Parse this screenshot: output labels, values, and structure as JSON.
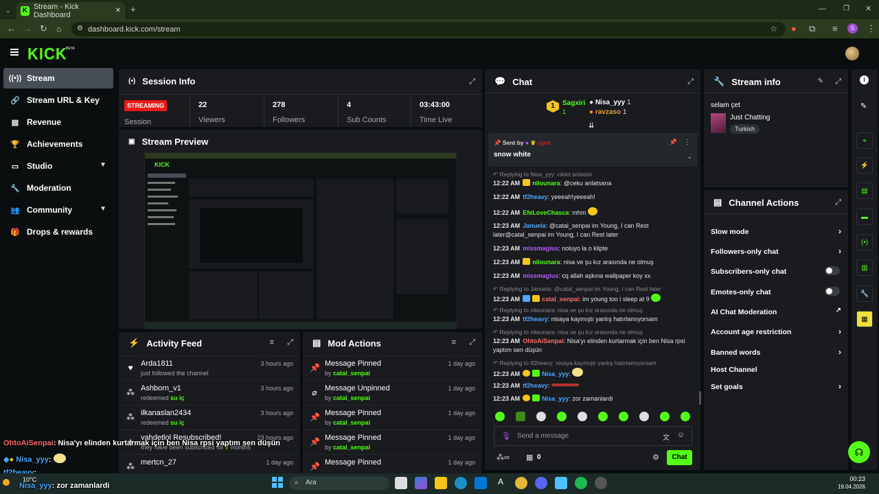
{
  "browser": {
    "tab_title": "Stream - Kick Dashboard",
    "url": "dashboard.kick.com/stream",
    "profile_initial": "S"
  },
  "header": {
    "logo": "KICK",
    "beta": "BETA"
  },
  "sidebar": {
    "items": [
      {
        "label": "Stream",
        "icon": "broadcast-icon",
        "active": true
      },
      {
        "label": "Stream URL & Key",
        "icon": "link-icon"
      },
      {
        "label": "Revenue",
        "icon": "chart-icon"
      },
      {
        "label": "Achievements",
        "icon": "trophy-icon"
      },
      {
        "label": "Studio",
        "icon": "studio-icon",
        "expandable": true
      },
      {
        "label": "Moderation",
        "icon": "wrench-icon"
      },
      {
        "label": "Community",
        "icon": "people-icon",
        "expandable": true
      },
      {
        "label": "Drops & rewards",
        "icon": "gift-icon"
      }
    ]
  },
  "session": {
    "title": "Session Info",
    "status_badge": "STREAMING",
    "status_label": "Session",
    "stats": [
      {
        "value": "22",
        "label": "Viewers"
      },
      {
        "value": "278",
        "label": "Followers"
      },
      {
        "value": "4",
        "label": "Sub Counts"
      },
      {
        "value": "03:43:00",
        "label": "Time Live"
      }
    ]
  },
  "preview": {
    "title": "Stream Preview"
  },
  "activity": {
    "title": "Activity Feed",
    "items": [
      {
        "name": "Arda1811",
        "sub": "just followed the channel",
        "time": "3 hours ago",
        "icon": "heart-icon"
      },
      {
        "name": "Ashborn_v1",
        "sub_prefix": "redeemed ",
        "sub_highlight": "su iç",
        "time": "3 hours ago",
        "icon": "points-icon"
      },
      {
        "name": "ilkanaslan2434",
        "sub_prefix": "redeemed ",
        "sub_highlight": "su iç",
        "time": "3 hours ago",
        "icon": "points-icon"
      },
      {
        "name": "vahdetlol Resubscribed!",
        "sub_prefix": "they have been subscribed for ",
        "sub_highlight": "7",
        "sub_suffix": " months",
        "time": "23 hours ago",
        "icon": "star-icon"
      },
      {
        "name": "mertcn_27",
        "sub": "",
        "time": "1 day ago",
        "icon": "points-icon"
      }
    ]
  },
  "modactions": {
    "title": "Mod Actions",
    "items": [
      {
        "action": "Message Pinned",
        "by": "catal_senpai",
        "time": "1 day ago",
        "icon": "pin-icon"
      },
      {
        "action": "Message Unpinned",
        "by": "catal_senpai",
        "time": "1 day ago",
        "icon": "unpin-icon"
      },
      {
        "action": "Message Pinned",
        "by": "catal_senpai",
        "time": "1 day ago",
        "icon": "pin-icon"
      },
      {
        "action": "Message Pinned",
        "by": "catal_senpai",
        "time": "1 day ago",
        "icon": "pin-icon"
      },
      {
        "action": "Message Pinned",
        "by": "",
        "time": "1 day ago",
        "icon": "pin-icon"
      }
    ],
    "by_prefix": "by "
  },
  "chat": {
    "title": "Chat",
    "top_gifters": [
      {
        "name": "Sagxiri",
        "count": "1"
      },
      {
        "name": "Nisa_yyy",
        "count": "1"
      },
      {
        "name": "ravzaso",
        "count": "1"
      }
    ],
    "pinned": {
      "sent_by": "Sent by",
      "user": "cjyet",
      "text": "snow white"
    },
    "messages": [
      {
        "reply": "Replying to Nisa_yyy: ciklet anlatsin"
      },
      {
        "ts": "12:22 AM",
        "user": "nilounara",
        "color": "#53fc18",
        "text": "@ceku anlatsana"
      },
      {
        "ts": "12:22 AM",
        "user": "tf2heavy",
        "color": "#4da6ff",
        "text": "yeeeah!yeeeah!"
      },
      {
        "ts": "12:22 AM",
        "user": "EfeLoveChasca",
        "color": "#53fc18",
        "text": "mhm"
      },
      {
        "ts": "12:23 AM",
        "user": "Januela",
        "color": "#4da6ff",
        "text": "@catal_senpai im Young, I can Rest later@catal_senpai im Young, I can Rest later"
      },
      {
        "ts": "12:23 AM",
        "user": "missmagius",
        "color": "#b45cff",
        "text": "noluyo la o klipte"
      },
      {
        "ts": "12:23 AM",
        "user": "nilounara",
        "color": "#53fc18",
        "text": "nisa ve şu kız arasında ne olmuş"
      },
      {
        "ts": "12:23 AM",
        "user": "missmagius",
        "color": "#b45cff",
        "text": "cq allah aşkına wallpaper koy xx"
      },
      {
        "reply": "Replying to Januela: @catal_senpai im Young, I can Rest later"
      },
      {
        "ts": "12:23 AM",
        "user": "catal_senpai",
        "color": "#ff6b6b",
        "text": "im young too i sleep at 9"
      },
      {
        "reply": "Replying to nilounara: nisa ve şu kız arasında ne olmuş"
      },
      {
        "ts": "12:23 AM",
        "user": "tf2heavy",
        "color": "#4da6ff",
        "text": "nisaya kaymıştı yanlış hatırlamıyorsam"
      },
      {
        "reply": "Replying to nilounara: nisa ve şu kız arasında ne olmuş"
      },
      {
        "ts": "12:23 AM",
        "user": "OhtoAiSenpai",
        "color": "#ff6b6b",
        "text": "Nisa'yı elinden kurtarmak için ben Nisa rpsi yaptım sen düşün"
      },
      {
        "reply": "Replying to tf2heavy: nisaya kaymıştı yanlış hatırlamıyorsam"
      },
      {
        "ts": "12:23 AM",
        "user": "Nisa_yyy",
        "color": "#4da6ff",
        "text": ""
      },
      {
        "ts": "12:23 AM",
        "user": "tf2heavy",
        "color": "#4da6ff",
        "text": ""
      },
      {
        "ts": "12:23 AM",
        "user": "Nisa_yyy",
        "color": "#4da6ff",
        "text": "zor zamanlardi"
      }
    ],
    "input_placeholder": "Send a message",
    "points": "0",
    "chat_button": "Chat"
  },
  "streaminfo": {
    "title": "Stream info",
    "stream_title": "selam çet",
    "category": "Just Chatting",
    "tag": "Turkish"
  },
  "channel_actions": {
    "title": "Channel Actions",
    "items": [
      {
        "label": "Slow mode",
        "control": "arrow"
      },
      {
        "label": "Followers-only chat",
        "control": "arrow"
      },
      {
        "label": "Subscribers-only chat",
        "control": "toggle"
      },
      {
        "label": "Emotes-only chat",
        "control": "toggle"
      },
      {
        "label": "AI Chat Moderation",
        "control": "external"
      },
      {
        "label": "Account age restriction",
        "control": "arrow"
      },
      {
        "label": "Banned words",
        "control": "arrow"
      },
      {
        "label": "Host Channel",
        "control": "none"
      },
      {
        "label": "Set goals",
        "control": "arrow"
      }
    ]
  },
  "overlay_chat": [
    {
      "user": "OhtoAiSenpai",
      "color": "#ff6b6b",
      "text": ": Nisa'yı elinden kurtarmak için ben Nisa rpsi yaptım sen düşün"
    },
    {
      "user": "Nisa_yyy",
      "color": "#4da6ff",
      "text": ":"
    },
    {
      "user": "tf2heavy",
      "color": "#4da6ff",
      "text": ":"
    },
    {
      "user": "Nisa_yyy",
      "color": "#4da6ff",
      "text": ": zor zamanlardi"
    }
  ],
  "taskbar": {
    "weather_temp": "10°C",
    "search_label": "Ara",
    "time": "00:23",
    "date": "19.04.2026"
  },
  "colors": {
    "accent": "#53fc18",
    "panel": "#191b1f",
    "bg": "#0b0e0f",
    "live": "#e91916"
  }
}
